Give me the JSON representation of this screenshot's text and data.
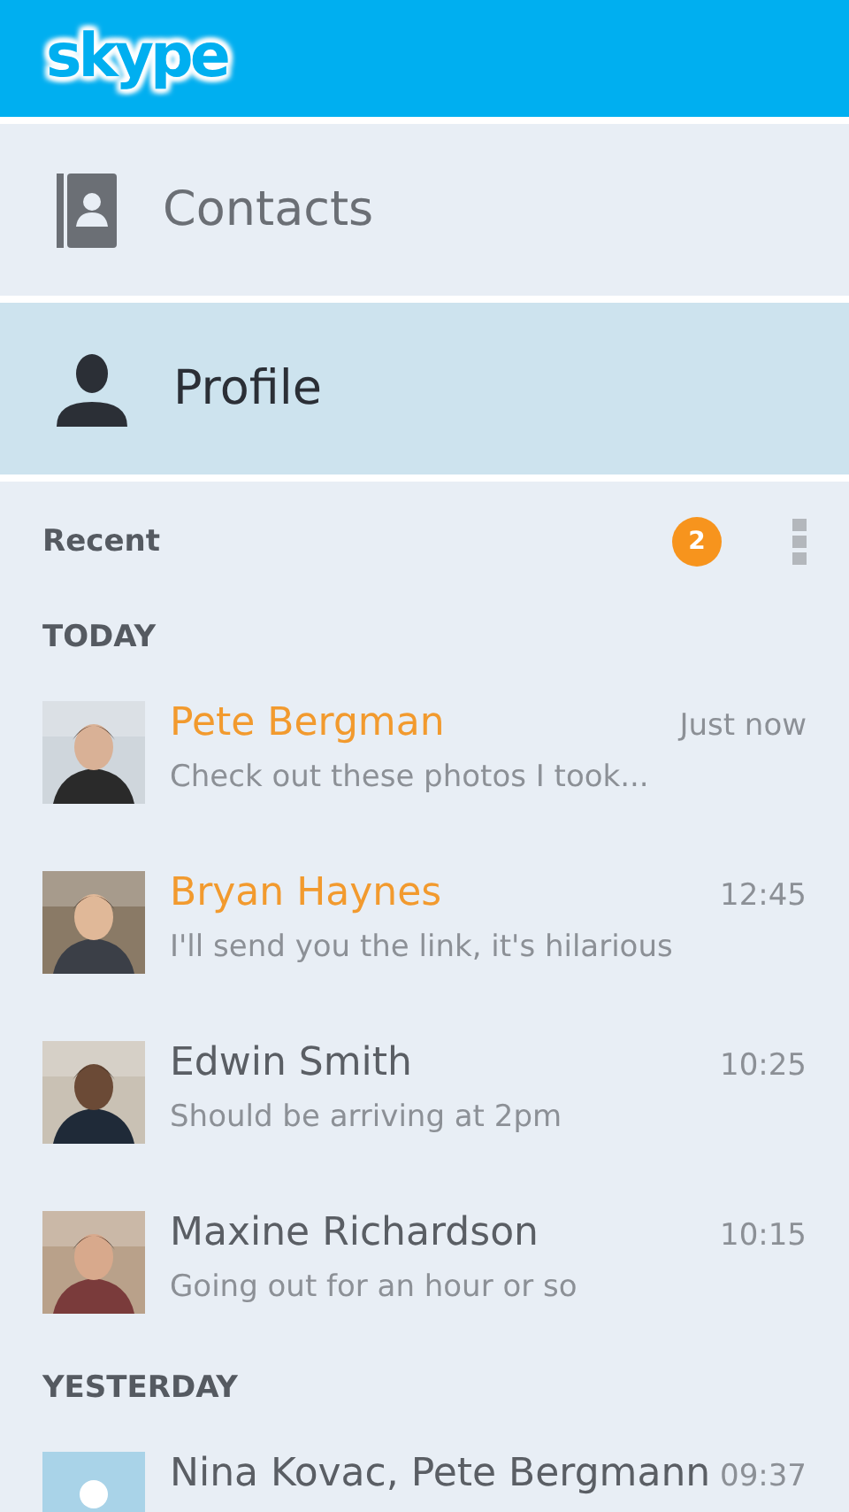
{
  "header": {
    "logo": "skype"
  },
  "nav": [
    {
      "label": "Contacts",
      "kind": "contacts",
      "selected": false
    },
    {
      "label": "Profile",
      "kind": "profile",
      "selected": true
    }
  ],
  "recent": {
    "title": "Recent",
    "badge": "2"
  },
  "groups": [
    {
      "title": "TODAY",
      "conversations": [
        {
          "name": "Pete Bergman",
          "time": "Just now",
          "message": "Check out these photos I took...",
          "unread": true,
          "kind": "picture"
        },
        {
          "name": "Bryan Haynes",
          "time": "12:45",
          "message": "I'll send you the link, it's hilarious",
          "unread": true,
          "kind": "picture"
        },
        {
          "name": "Edwin Smith",
          "time": "10:25",
          "message": "Should be arriving at 2pm",
          "unread": false,
          "kind": "picture"
        },
        {
          "name": "Maxine Richardson",
          "time": "10:15",
          "message": "Going out for an hour or so",
          "unread": false,
          "kind": "picture"
        }
      ]
    },
    {
      "title": "YESTERDAY",
      "conversations": [
        {
          "name": "Nina Kovac, Pete Bergmann",
          "time": "09:37",
          "unread": false,
          "kind": "placeholder"
        }
      ]
    }
  ]
}
